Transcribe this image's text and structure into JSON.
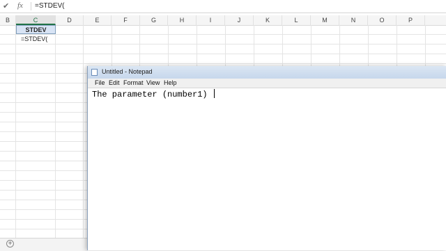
{
  "formula_bar": {
    "check_icon": "checkmark-icon",
    "fx_label": "fx",
    "formula": "=STDEV("
  },
  "columns": [
    "B",
    "C",
    "D",
    "E",
    "F",
    "G",
    "H",
    "I",
    "J",
    "K",
    "L",
    "M",
    "N",
    "O",
    "P"
  ],
  "cells": {
    "C1": "STDEV",
    "C2": "=STDEV("
  },
  "sheet_bar": {
    "add_sheet": "+"
  },
  "notepad": {
    "title": "Untitled - Notepad",
    "menu": [
      "File",
      "Edit",
      "Format",
      "View",
      "Help"
    ],
    "content": "The parameter (number1) "
  }
}
